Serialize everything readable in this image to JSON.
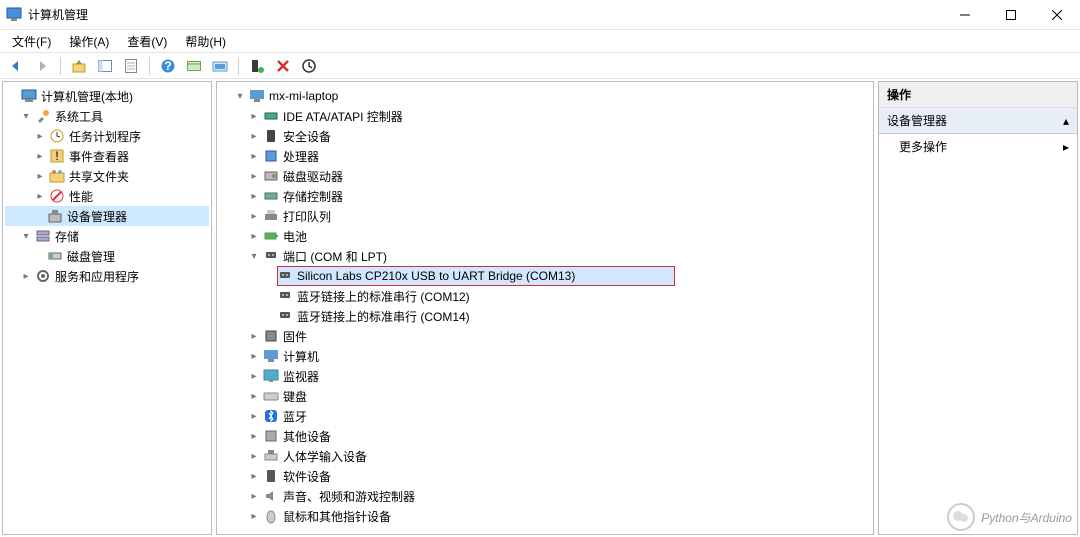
{
  "window": {
    "title": "计算机管理"
  },
  "menu": {
    "file": "文件(F)",
    "action": "操作(A)",
    "view": "查看(V)",
    "help": "帮助(H)"
  },
  "left_tree": {
    "root": "计算机管理(本地)",
    "sys_tools": "系统工具",
    "task_scheduler": "任务计划程序",
    "event_viewer": "事件查看器",
    "shared_folders": "共享文件夹",
    "performance": "性能",
    "device_manager": "设备管理器",
    "storage": "存储",
    "disk_mgmt": "磁盘管理",
    "services_apps": "服务和应用程序"
  },
  "center_tree": {
    "root": "mx-mi-laptop",
    "ide": "IDE ATA/ATAPI 控制器",
    "security": "安全设备",
    "processors": "处理器",
    "disk_drives": "磁盘驱动器",
    "storage_ctrl": "存储控制器",
    "print_queues": "打印队列",
    "batteries": "电池",
    "ports": "端口 (COM 和 LPT)",
    "port_cp210x": "Silicon Labs CP210x USB to UART Bridge (COM13)",
    "port_bt12": "蓝牙链接上的标准串行 (COM12)",
    "port_bt14": "蓝牙链接上的标准串行 (COM14)",
    "firmware": "固件",
    "computer": "计算机",
    "monitors": "监视器",
    "keyboards": "键盘",
    "bluetooth": "蓝牙",
    "other": "其他设备",
    "hid": "人体学输入设备",
    "software_devices": "软件设备",
    "sound": "声音、视频和游戏控制器",
    "mice": "鼠标和其他指针设备"
  },
  "actions": {
    "header": "操作",
    "device_mgr": "设备管理器",
    "more": "更多操作"
  },
  "watermark": "Python与Arduino"
}
